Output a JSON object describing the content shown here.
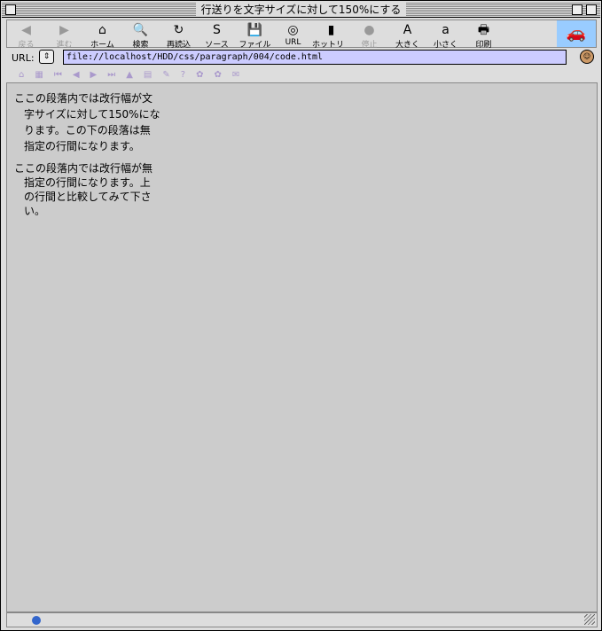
{
  "window": {
    "title": "行送りを文字サイズに対して150%にする"
  },
  "toolbar": [
    {
      "label": "戻る",
      "icon": "◀",
      "disabled": true
    },
    {
      "label": "進む",
      "icon": "▶",
      "disabled": true
    },
    {
      "label": "ホーム",
      "icon": "⌂",
      "disabled": false
    },
    {
      "label": "検索",
      "icon": "🔍",
      "disabled": false
    },
    {
      "label": "再読込",
      "icon": "↻",
      "disabled": false
    },
    {
      "label": "ソース",
      "icon": "S",
      "disabled": false
    },
    {
      "label": "ファイル",
      "icon": "💾",
      "disabled": false
    },
    {
      "label": "URL",
      "icon": "◎",
      "disabled": false
    },
    {
      "label": "ホットリスト",
      "icon": "▮",
      "disabled": false
    },
    {
      "label": "停止",
      "icon": "●",
      "disabled": true
    },
    {
      "label": "大きく",
      "icon": "A",
      "disabled": false
    },
    {
      "label": "小さく",
      "icon": "a",
      "disabled": false
    },
    {
      "label": "印刷",
      "icon": "🖶",
      "disabled": false
    }
  ],
  "url": {
    "label": "URL:",
    "value": "file://localhost/HDD/css/paragraph/004/code.html"
  },
  "content": {
    "p1": "ここの段落内では改行幅が文字サイズに対して150%になります。この下の段落は無指定の行間になります。",
    "p2": "ここの段落内では改行幅が無指定の行間になります。上の行間と比較してみて下さい。"
  }
}
